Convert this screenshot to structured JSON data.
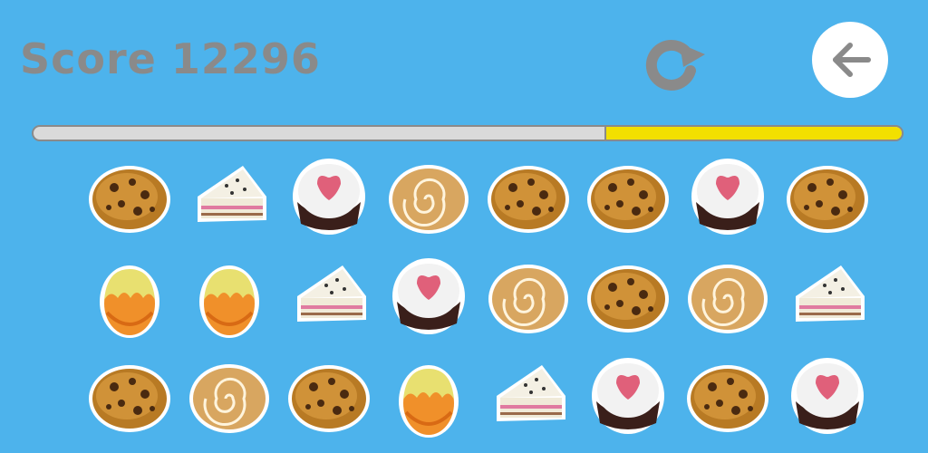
{
  "hud": {
    "score_label": "Score",
    "score_value": "12296",
    "restart_icon": "restart-icon",
    "back_icon": "back-arrow-icon"
  },
  "progress": {
    "remaining_fraction": 0.34
  },
  "colors": {
    "background": "#4db3ec",
    "hud_text": "#8a8a8a",
    "progress_track": "#dadada",
    "progress_fill": "#f2e000"
  },
  "board": {
    "rows": 3,
    "cols": 8,
    "tiles": [
      [
        "cookie",
        "cake-slice",
        "cupcake",
        "cinnamon-roll",
        "cookie",
        "cookie",
        "cupcake",
        "cookie"
      ],
      [
        "egg",
        "egg",
        "cake-slice",
        "cupcake",
        "cinnamon-roll",
        "cookie",
        "cinnamon-roll",
        "cake-slice"
      ],
      [
        "cookie",
        "cinnamon-roll",
        "cookie",
        "egg",
        "cake-slice",
        "cupcake",
        "cookie",
        "cupcake"
      ]
    ]
  }
}
